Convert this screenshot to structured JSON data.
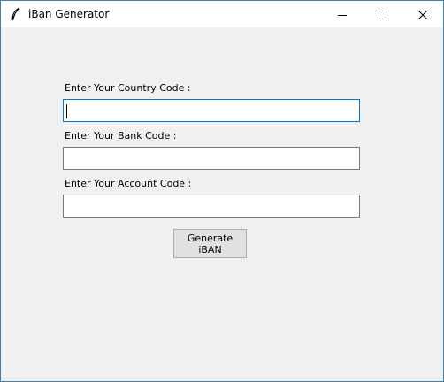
{
  "window": {
    "title": "iBan Generator",
    "app_icon": "feather-icon",
    "controls": [
      "minimize-icon",
      "maximize-icon",
      "close-icon"
    ]
  },
  "form": {
    "country_label": "Enter Your Country Code :",
    "country_value": "",
    "bank_label": "Enter Your Bank Code :",
    "bank_value": "",
    "account_label": "Enter Your Account Code :",
    "account_value": "",
    "generate_button": "Generate iBAN"
  },
  "colors": {
    "focus_border": "#0078d7",
    "window_border": "#3c7fb1",
    "background": "#f0f0f0"
  }
}
